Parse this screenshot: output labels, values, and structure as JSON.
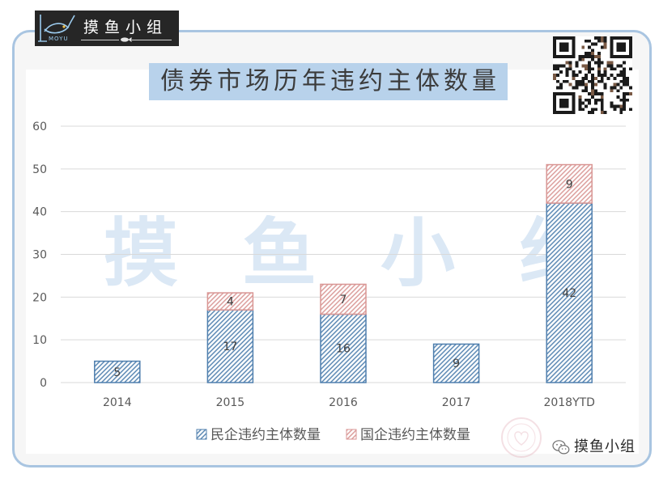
{
  "logo": {
    "icon": "moyu-fish-logo-icon",
    "mark_text": "MOYU",
    "name": "摸鱼小组"
  },
  "qr_code": {
    "icon": "qr-code-icon"
  },
  "watermark": {
    "text": "摸鱼小组"
  },
  "footer_brand": {
    "icon": "wechat-icon",
    "name": "摸鱼小组"
  },
  "seal": {
    "icon": "seal-watermark-icon"
  },
  "colors": {
    "card_border": "#a9c5e1",
    "title_background": "#b8d2eb",
    "watermark": "#dbe8f5",
    "grid": "#d9d9d9",
    "qr_dark": "#1b1b1b",
    "qr_accent": "#7a5a45"
  },
  "chart_data": {
    "type": "bar",
    "stacked": true,
    "title": "债券市场历年违约主体数量",
    "xlabel": "",
    "ylabel": "",
    "categories": [
      "2014",
      "2015",
      "2016",
      "2017",
      "2018YTD"
    ],
    "series": [
      {
        "name": "民企违约主体数量",
        "color": "#4f7fae",
        "values": [
          5,
          17,
          16,
          9,
          42
        ]
      },
      {
        "name": "国企违约主体数量",
        "color": "#d99694",
        "values": [
          null,
          4,
          7,
          null,
          9
        ]
      }
    ],
    "ylim": [
      0,
      60
    ],
    "yticks": [
      0,
      10,
      20,
      30,
      40,
      50,
      60
    ],
    "grid": true,
    "legend": "bottom"
  }
}
